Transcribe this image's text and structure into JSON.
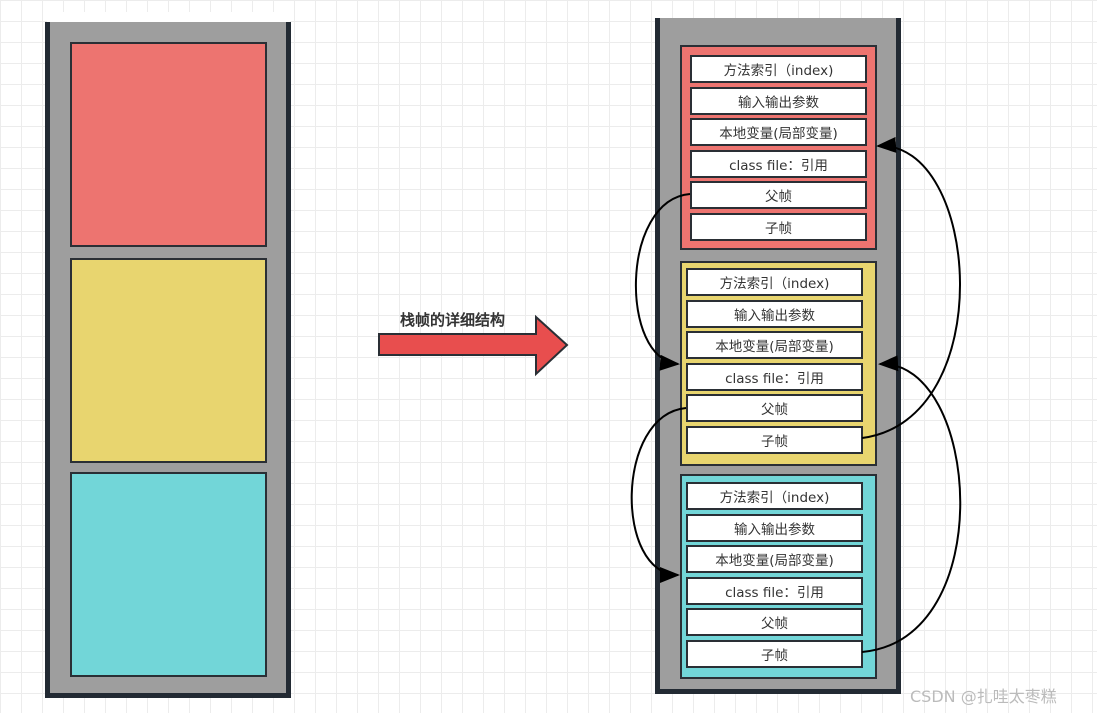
{
  "colors": {
    "red": "#ed7470",
    "yellow": "#e8d56f",
    "cyan": "#72d6d8",
    "stack": "#9e9e9e",
    "arrow": "#e84e4e"
  },
  "left_stack": {
    "blocks": [
      "red",
      "yellow",
      "cyan"
    ]
  },
  "arrow_label": "栈帧的详细结构",
  "frames": [
    {
      "color": "red",
      "rows": [
        "方法索引（index)",
        "输入输出参数",
        "本地变量(局部变量)",
        "class file：引用",
        "父帧",
        "子帧"
      ]
    },
    {
      "color": "yellow",
      "rows": [
        "方法索引（index)",
        "输入输出参数",
        "本地变量(局部变量)",
        "class file：引用",
        "父帧",
        "子帧"
      ]
    },
    {
      "color": "cyan",
      "rows": [
        "方法索引（index)",
        "输入输出参数",
        "本地变量(局部变量)",
        "class file：引用",
        "父帧",
        "子帧"
      ]
    }
  ],
  "watermark": "CSDN @扎哇太枣糕"
}
